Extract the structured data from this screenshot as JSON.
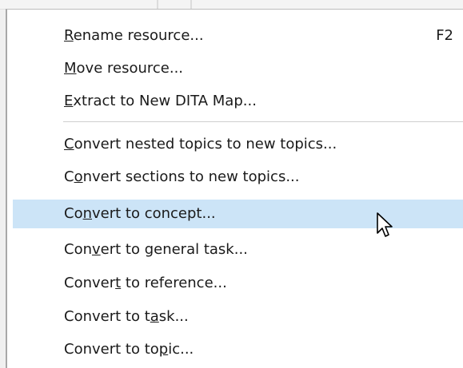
{
  "menu": {
    "items": [
      {
        "pre": "",
        "mn": "R",
        "post": "ename resource...",
        "shortcut": "F2"
      },
      {
        "pre": "",
        "mn": "M",
        "post": "ove resource..."
      },
      {
        "pre": "",
        "mn": "E",
        "post": "xtract to New DITA Map..."
      },
      {
        "pre": "",
        "mn": "C",
        "post": "onvert nested topics to new topics..."
      },
      {
        "pre": "C",
        "mn": "o",
        "post": "nvert sections to new topics..."
      },
      {
        "pre": "Co",
        "mn": "n",
        "post": "vert to concept..."
      },
      {
        "pre": "Con",
        "mn": "v",
        "post": "ert to general task..."
      },
      {
        "pre": "Conver",
        "mn": "t",
        "post": " to reference..."
      },
      {
        "pre": "Convert to t",
        "mn": "a",
        "post": "sk..."
      },
      {
        "pre": "Convert to to",
        "mn": "p",
        "post": "ic..."
      }
    ]
  },
  "highlighted_item": "Convert to concept...",
  "colors": {
    "highlight": "#cce4f7",
    "menu_background": "#ffffff",
    "text": "#1a1a1a"
  },
  "icons": {
    "cursor": "arrow-pointer-icon"
  }
}
